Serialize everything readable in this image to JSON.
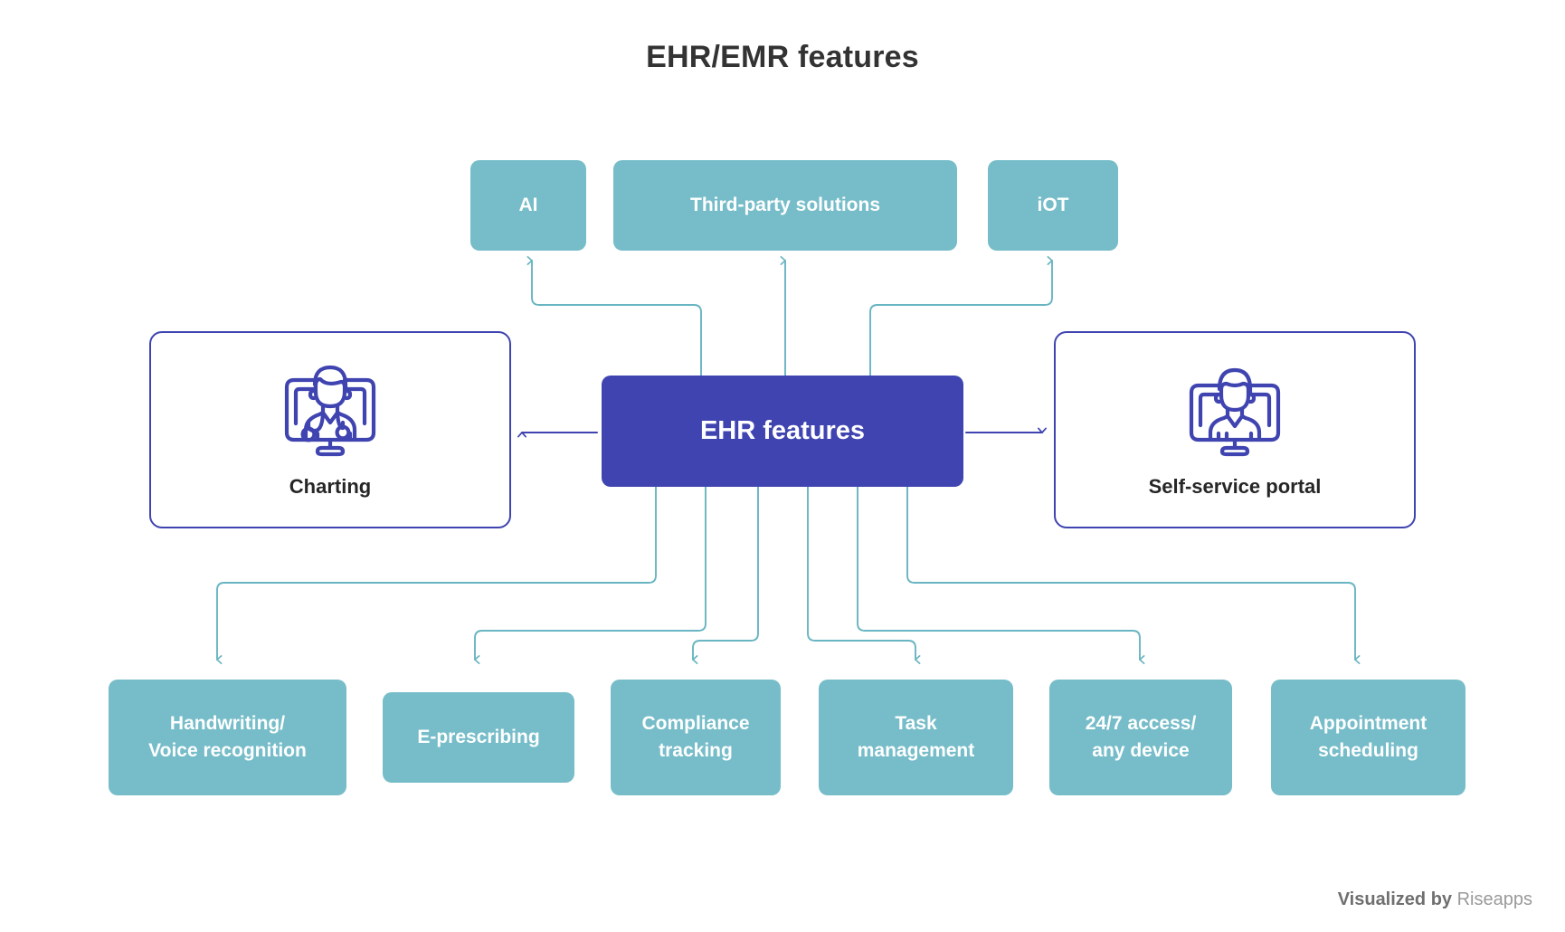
{
  "title": "EHR/EMR features",
  "colors": {
    "teal": "#76bdc9",
    "indigo": "#3f44b0",
    "title_text": "#333333",
    "card_text": "#262626",
    "footer_muted": "#9a9a9a",
    "footer_strong": "#6f6f6f",
    "background": "#ffffff"
  },
  "center": {
    "label": "EHR features"
  },
  "top_nodes": [
    {
      "label": "AI"
    },
    {
      "label": "Third-party solutions"
    },
    {
      "label": "iOT"
    }
  ],
  "side_cards": [
    {
      "caption": "Charting",
      "icon": "doctor-on-monitor-icon"
    },
    {
      "caption": "Self-service portal",
      "icon": "patient-on-monitor-icon"
    }
  ],
  "bottom_nodes": [
    {
      "line1": "Handwriting/",
      "line2": "Voice recognition"
    },
    {
      "line1": "E-prescribing",
      "line2": ""
    },
    {
      "line1": "Compliance",
      "line2": "tracking"
    },
    {
      "line1": "Task",
      "line2": "management"
    },
    {
      "line1": "24/7 access/",
      "line2": "any device"
    },
    {
      "line1": "Appointment",
      "line2": "scheduling"
    }
  ],
  "footer": {
    "strong": "Visualized by",
    "muted": "Riseapps"
  }
}
